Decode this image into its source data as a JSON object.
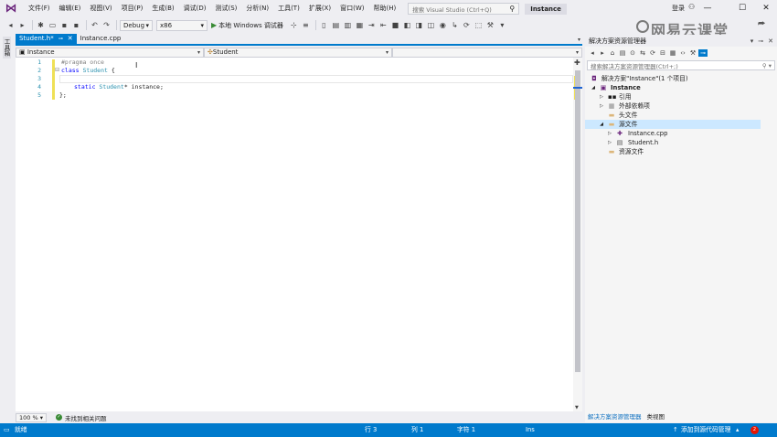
{
  "menu": [
    "文件(F)",
    "编辑(E)",
    "视图(V)",
    "项目(P)",
    "生成(B)",
    "调试(D)",
    "测试(S)",
    "分析(N)",
    "工具(T)",
    "扩展(X)",
    "窗口(W)",
    "帮助(H)"
  ],
  "quick_launch": {
    "placeholder": "搜索 Visual Studio (Ctrl+Q)"
  },
  "solution_title": "Instance",
  "account": {
    "login": "登录"
  },
  "watermark": "网易云课堂",
  "toolbar": {
    "config": "Debug",
    "platform": "x86",
    "run_label": "本地 Windows 调试器"
  },
  "left_strip": {
    "label": "工具箱"
  },
  "tabs": [
    {
      "label": "Student.h*",
      "active": true
    },
    {
      "label": "Instance.cpp",
      "active": false
    }
  ],
  "navbar": {
    "project": "Instance",
    "scope": "Student",
    "member": ""
  },
  "code": {
    "lines": [
      {
        "num": "1",
        "pp": "#pragma once"
      },
      {
        "num": "2",
        "kw": "class",
        "ty": "Student",
        "rest": " {"
      },
      {
        "num": "3"
      },
      {
        "num": "4",
        "kw": "static",
        "ty": "Student",
        "rest": "* instance;"
      },
      {
        "num": "5",
        "rest": "};"
      }
    ]
  },
  "editor_bottom": {
    "zoom": "100 %",
    "issues": "未找到相关问题"
  },
  "solution_explorer": {
    "title": "解决方案资源管理器",
    "search_placeholder": "搜索解决方案资源管理器(Ctrl+;)",
    "tree": [
      {
        "label": "解决方案\"Instance\"(1 个项目)",
        "icon": "solution-icon",
        "level": 0
      },
      {
        "label": "Instance",
        "icon": "project-icon",
        "level": 1,
        "bold": true
      },
      {
        "label": "引用",
        "icon": "references-icon",
        "level": 2
      },
      {
        "label": "外部依赖项",
        "icon": "external-deps-icon",
        "level": 2
      },
      {
        "label": "头文件",
        "icon": "folder-icon",
        "level": 2
      },
      {
        "label": "源文件",
        "icon": "folder-open-icon",
        "level": 2,
        "selected": true
      },
      {
        "label": "Instance.cpp",
        "icon": "cpp-file-icon",
        "level": 3
      },
      {
        "label": "Student.h",
        "icon": "header-file-icon",
        "level": 3
      },
      {
        "label": "资源文件",
        "icon": "folder-icon",
        "level": 2
      }
    ],
    "tabs": [
      "解决方案资源管理器",
      "类视图"
    ]
  },
  "status": {
    "ready": "就绪",
    "line": "行 3",
    "col": "列 1",
    "char": "字符 1",
    "ins": "Ins",
    "source_control": "添加到源代码管理",
    "badge": "2"
  },
  "colors": {
    "accent": "#007acc",
    "keyword": "#0000ff",
    "type": "#2b91af",
    "preprocessor": "#808080"
  }
}
